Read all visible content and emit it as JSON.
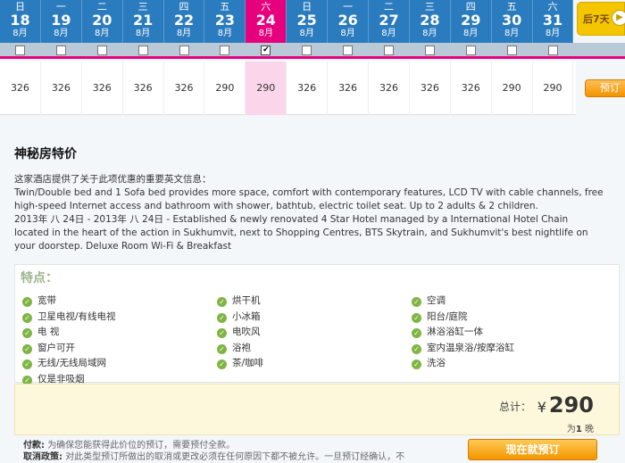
{
  "calendar": {
    "days": [
      {
        "weekday": "日",
        "day": "18",
        "month": "8月",
        "price": "326",
        "selected": false
      },
      {
        "weekday": "一",
        "day": "19",
        "month": "8月",
        "price": "326",
        "selected": false
      },
      {
        "weekday": "二",
        "day": "20",
        "month": "8月",
        "price": "326",
        "selected": false
      },
      {
        "weekday": "三",
        "day": "21",
        "month": "8月",
        "price": "326",
        "selected": false
      },
      {
        "weekday": "四",
        "day": "22",
        "month": "8月",
        "price": "326",
        "selected": false
      },
      {
        "weekday": "五",
        "day": "23",
        "month": "8月",
        "price": "290",
        "selected": false
      },
      {
        "weekday": "六",
        "day": "24",
        "month": "8月",
        "price": "290",
        "selected": true
      },
      {
        "weekday": "日",
        "day": "25",
        "month": "8月",
        "price": "326",
        "selected": false
      },
      {
        "weekday": "一",
        "day": "26",
        "month": "8月",
        "price": "326",
        "selected": false
      },
      {
        "weekday": "二",
        "day": "27",
        "month": "8月",
        "price": "326",
        "selected": false
      },
      {
        "weekday": "三",
        "day": "28",
        "month": "8月",
        "price": "326",
        "selected": false
      },
      {
        "weekday": "四",
        "day": "29",
        "month": "8月",
        "price": "326",
        "selected": false
      },
      {
        "weekday": "五",
        "day": "30",
        "month": "8月",
        "price": "290",
        "selected": false
      },
      {
        "weekday": "六",
        "day": "31",
        "month": "8月",
        "price": "290",
        "selected": false
      }
    ],
    "next_label": "后7天",
    "book_small_label": "预订"
  },
  "promo": {
    "title": "神秘房特价",
    "intro": "这家酒店提供了关于此项优惠的重要英文信息：",
    "line1": "Twin/Double bed and 1 Sofa bed provides more space, comfort with contemporary features, LCD TV with cable channels, free high-speed Internet access and bathroom with shower, bathtub, electric toilet seat. Up to 2 adults & 2 children.",
    "line2": "2013年 八 24日 - 2013年 八 24日 - Established & newly renovated 4 Star Hotel managed by a International Hotel Chain located in the heart of the action in Sukhumvit, next to Shopping Centres, BTS Skytrain, and Sukhumvit's best nightlife on your doorstep. Deluxe Room Wi-Fi & Breakfast"
  },
  "features": {
    "title": "特点：",
    "items": [
      "宽带",
      "卫星电视/有线电视",
      "电 视",
      "窗户可开",
      "无线/无线局域网",
      "仅是非吸烟",
      "烘干机",
      "小冰箱",
      "电吹风",
      "浴袍",
      "茶/咖啡",
      "空调",
      "阳台/庭院",
      "淋浴浴缸一体",
      "室内温泉浴/按摩浴缸",
      "洗浴"
    ]
  },
  "total": {
    "label": "总计：",
    "currency": "¥",
    "amount": "290",
    "per_prefix": "为",
    "per_count": "1",
    "per_suffix": "晚"
  },
  "footer": {
    "payment_label": "付款:",
    "payment_text": "为确保您能获得此价位的预订，需要预付全款。",
    "cancel_label": "取消政策:",
    "cancel_text": "对此类型预订所做出的取消或更改必须在任何原因下都不被允许。一旦预订经确认，不",
    "book_now": "现在就预订"
  }
}
